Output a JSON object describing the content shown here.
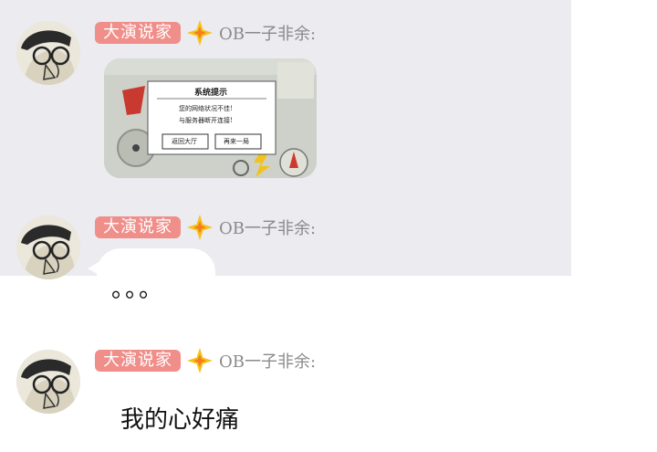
{
  "messages": [
    {
      "badge": "大演说家",
      "nickname": "OB一子非余:",
      "attachment": {
        "dialog_title": "系统提示",
        "dialog_line1": "您的网络状况不佳!",
        "dialog_line2": "与服务器断开连接!",
        "button_lobby": "返回大厅",
        "button_again": "再来一局"
      }
    },
    {
      "badge": "大演说家",
      "nickname": "OB一子非余:",
      "text": "。。。"
    },
    {
      "badge": "大演说家",
      "nickname": "OB一子非余:",
      "text": "我的心好痛"
    }
  ],
  "colors": {
    "badge": "#f08e8a",
    "star": "#f7c21d",
    "nickname": "#8a8a8a",
    "chat_bg": "#ebebf0"
  },
  "icons": {
    "level": "star-icon",
    "avatar": "avatar-image"
  }
}
